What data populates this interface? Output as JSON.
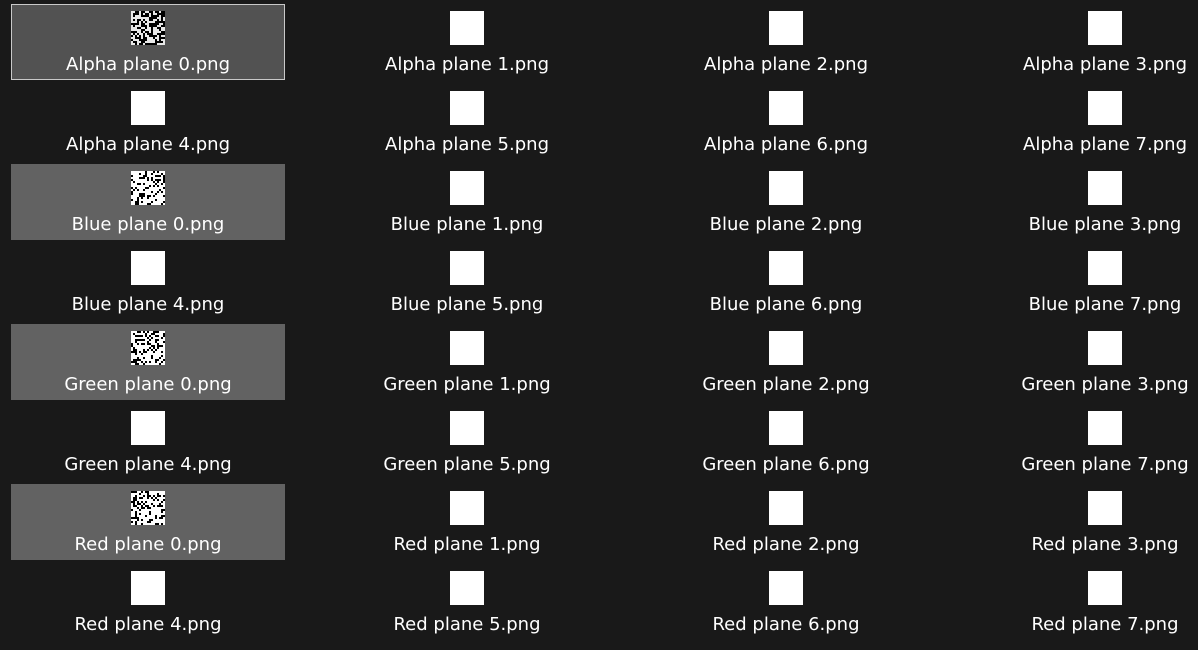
{
  "files": [
    {
      "name": "Alpha plane 0.png",
      "thumbnail": "noise",
      "state": "focused"
    },
    {
      "name": "Alpha plane 1.png",
      "thumbnail": "white"
    },
    {
      "name": "Alpha plane 2.png",
      "thumbnail": "white"
    },
    {
      "name": "Alpha plane 3.png",
      "thumbnail": "white"
    },
    {
      "name": "Alpha plane 4.png",
      "thumbnail": "white"
    },
    {
      "name": "Alpha plane 5.png",
      "thumbnail": "white"
    },
    {
      "name": "Alpha plane 6.png",
      "thumbnail": "white"
    },
    {
      "name": "Alpha plane 7.png",
      "thumbnail": "white"
    },
    {
      "name": "Blue plane 0.png",
      "thumbnail": "noise",
      "state": "selected"
    },
    {
      "name": "Blue plane 1.png",
      "thumbnail": "white"
    },
    {
      "name": "Blue plane 2.png",
      "thumbnail": "white"
    },
    {
      "name": "Blue plane 3.png",
      "thumbnail": "white"
    },
    {
      "name": "Blue plane 4.png",
      "thumbnail": "white"
    },
    {
      "name": "Blue plane 5.png",
      "thumbnail": "white"
    },
    {
      "name": "Blue plane 6.png",
      "thumbnail": "white"
    },
    {
      "name": "Blue plane 7.png",
      "thumbnail": "white"
    },
    {
      "name": "Green plane 0.png",
      "thumbnail": "noise",
      "state": "selected"
    },
    {
      "name": "Green plane 1.png",
      "thumbnail": "white"
    },
    {
      "name": "Green plane 2.png",
      "thumbnail": "white"
    },
    {
      "name": "Green plane 3.png",
      "thumbnail": "white"
    },
    {
      "name": "Green plane 4.png",
      "thumbnail": "white"
    },
    {
      "name": "Green plane 5.png",
      "thumbnail": "white"
    },
    {
      "name": "Green plane 6.png",
      "thumbnail": "white"
    },
    {
      "name": "Green plane 7.png",
      "thumbnail": "white"
    },
    {
      "name": "Red plane 0.png",
      "thumbnail": "noise",
      "state": "selected"
    },
    {
      "name": "Red plane 1.png",
      "thumbnail": "white"
    },
    {
      "name": "Red plane 2.png",
      "thumbnail": "white"
    },
    {
      "name": "Red plane 3.png",
      "thumbnail": "white"
    },
    {
      "name": "Red plane 4.png",
      "thumbnail": "white"
    },
    {
      "name": "Red plane 5.png",
      "thumbnail": "white"
    },
    {
      "name": "Red plane 6.png",
      "thumbnail": "white"
    },
    {
      "name": "Red plane 7.png",
      "thumbnail": "white"
    }
  ]
}
